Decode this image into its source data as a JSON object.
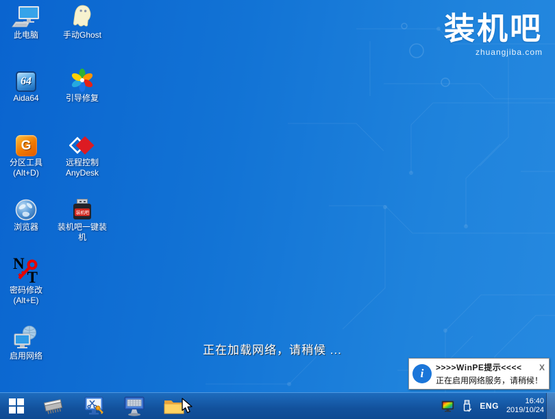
{
  "desktop": {
    "wallpaper": {
      "color_left": "#0a64cf",
      "color_right": "#2689e0",
      "circuit_line_color": "rgba(255,255,255,0.08)"
    },
    "logo": {
      "title": "装机吧",
      "subtitle": "zhuangjiba.com"
    },
    "loading_message": "正在加载网络，请稍候 ...",
    "icons": [
      {
        "id": "this-pc",
        "label": "此电脑"
      },
      {
        "id": "manual-ghost",
        "label": "手动Ghost"
      },
      {
        "id": "aida64",
        "label": "Aida64",
        "glyph": "64"
      },
      {
        "id": "boot-repair",
        "label": "引导修复"
      },
      {
        "id": "partition-tool",
        "label": "分区工具",
        "label2": "(Alt+D)",
        "glyph": "G"
      },
      {
        "id": "anydesk",
        "label": "远程控制",
        "label2": "AnyDesk"
      },
      {
        "id": "browser",
        "label": "浏览器"
      },
      {
        "id": "onekey-install",
        "label": "装机吧一键装机",
        "badge": "装机吧"
      },
      {
        "id": "password-reset",
        "label": "密码修改",
        "label2": "(Alt+E)",
        "letter1": "N",
        "letter2": "T"
      },
      {
        "id": "enable-network",
        "label": "启用网络"
      }
    ]
  },
  "notification": {
    "icon_glyph": "i",
    "title": ">>>>WinPE提示<<<<",
    "close_label": "X",
    "message": "正在启用网络服务，请稍候！",
    "accent_color": "#1b76d9"
  },
  "taskbar": {
    "color": "#12519c",
    "tray": {
      "language": "ENG",
      "time": "16:40",
      "date": "2019/10/24"
    }
  }
}
